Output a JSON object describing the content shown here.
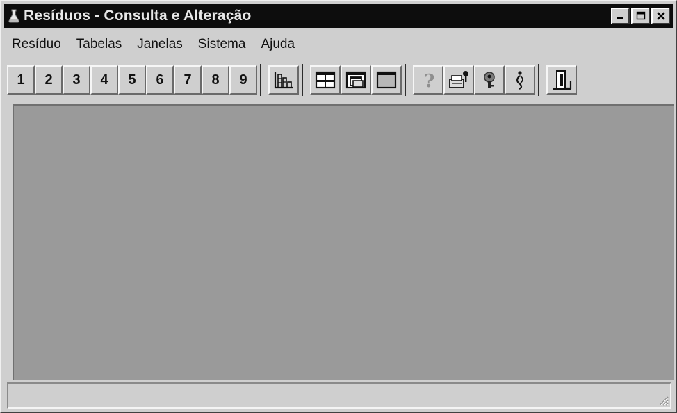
{
  "window": {
    "title": "Resíduos - Consulta e Alteração",
    "controls": [
      "minimize-icon",
      "maximize-icon",
      "close-icon"
    ]
  },
  "menu": {
    "items": [
      {
        "key": "R",
        "rest": "esíduo"
      },
      {
        "key": "T",
        "rest": "abelas"
      },
      {
        "key": "J",
        "rest": "anelas"
      },
      {
        "key": "S",
        "rest": "istema"
      },
      {
        "key": "A",
        "rest": "juda"
      }
    ]
  },
  "toolbar": {
    "numbers": [
      "1",
      "2",
      "3",
      "4",
      "5",
      "6",
      "7",
      "8",
      "9"
    ],
    "icons": [
      "chart-icon",
      "tile-windows-icon",
      "cascade-windows-icon",
      "window-icon",
      "help-icon",
      "print-icon",
      "key-icon",
      "info-icon",
      "exit-door-icon"
    ]
  },
  "status": {
    "text": ""
  },
  "colors": {
    "titlebar": "#0d0d0d",
    "workspace": "#9a9a9a",
    "face": "#cfcfcf"
  }
}
